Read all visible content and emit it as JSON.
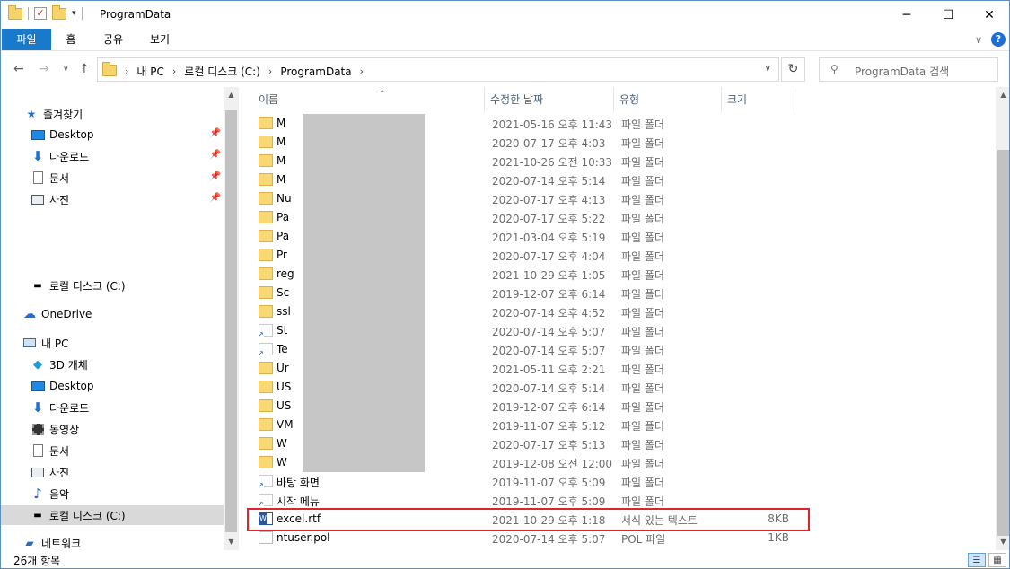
{
  "window": {
    "title": "ProgramData",
    "minimize_glyph": "─",
    "maximize_glyph": "☐",
    "close_glyph": "✕"
  },
  "ribbon": {
    "tabs": [
      "파일",
      "홈",
      "공유",
      "보기"
    ],
    "expand_glyph": "∨",
    "help_glyph": "?"
  },
  "address": {
    "crumbs": [
      "내 PC",
      "로컬 디스크 (C:)",
      "ProgramData"
    ],
    "separator": "›",
    "refresh_glyph": "↻"
  },
  "search": {
    "placeholder": "ProgramData 검색"
  },
  "nav": {
    "quick_access": "즐겨찾기",
    "quick_items": [
      {
        "label": "Desktop",
        "icon": "desktop-icon"
      },
      {
        "label": "다운로드",
        "icon": "download-icon"
      },
      {
        "label": "문서",
        "icon": "document-icon"
      },
      {
        "label": "사진",
        "icon": "picture-icon"
      }
    ],
    "local_disk": "로컬 디스크 (C:)",
    "onedrive": "OneDrive",
    "this_pc": "내 PC",
    "pc_items": [
      {
        "label": "3D 개체",
        "icon": "3d-objects-icon"
      },
      {
        "label": "Desktop",
        "icon": "desktop-icon"
      },
      {
        "label": "다운로드",
        "icon": "download-icon"
      },
      {
        "label": "동영상",
        "icon": "video-icon"
      },
      {
        "label": "문서",
        "icon": "document-icon"
      },
      {
        "label": "사진",
        "icon": "picture-icon"
      },
      {
        "label": "음악",
        "icon": "music-icon"
      },
      {
        "label": "로컬 디스크 (C:)",
        "icon": "drive-icon"
      }
    ],
    "network": "네트워크"
  },
  "columns": {
    "name": "이름",
    "modified": "수정한 날짜",
    "type": "유형",
    "size": "크기"
  },
  "files": [
    {
      "name": "M",
      "date": "2021-05-16 오후 11:43",
      "type": "파일 폴더",
      "size": "",
      "kind": "folder"
    },
    {
      "name": "M",
      "date": "2020-07-17 오후 4:03",
      "type": "파일 폴더",
      "size": "",
      "kind": "folder"
    },
    {
      "name": "M",
      "date": "2021-10-26 오전 10:33",
      "type": "파일 폴더",
      "size": "",
      "kind": "folder"
    },
    {
      "name": "M",
      "date": "2020-07-14 오후 5:14",
      "type": "파일 폴더",
      "size": "",
      "kind": "folder"
    },
    {
      "name": "Nu",
      "date": "2020-07-17 오후 4:13",
      "type": "파일 폴더",
      "size": "",
      "kind": "folder"
    },
    {
      "name": "Pa",
      "date": "2020-07-17 오후 5:22",
      "type": "파일 폴더",
      "size": "",
      "kind": "folder"
    },
    {
      "name": "Pa",
      "date": "2021-03-04 오후 5:19",
      "type": "파일 폴더",
      "size": "",
      "kind": "folder"
    },
    {
      "name": "Pr",
      "date": "2020-07-17 오후 4:04",
      "type": "파일 폴더",
      "size": "",
      "kind": "folder"
    },
    {
      "name": "reg",
      "date": "2021-10-29 오후 1:05",
      "type": "파일 폴더",
      "size": "",
      "kind": "folder"
    },
    {
      "name": "Sc",
      "date": "2019-12-07 오후 6:14",
      "type": "파일 폴더",
      "size": "",
      "kind": "folder"
    },
    {
      "name": "ssl",
      "date": "2020-07-14 오후 4:52",
      "type": "파일 폴더",
      "size": "",
      "kind": "folder"
    },
    {
      "name": "St",
      "date": "2020-07-14 오후 5:07",
      "type": "파일 폴더",
      "size": "",
      "kind": "shortcut"
    },
    {
      "name": "Te",
      "date": "2020-07-14 오후 5:07",
      "type": "파일 폴더",
      "size": "",
      "kind": "shortcut"
    },
    {
      "name": "Ur",
      "date": "2021-05-11 오후 2:21",
      "type": "파일 폴더",
      "size": "",
      "kind": "folder"
    },
    {
      "name": "US",
      "date": "2020-07-14 오후 5:14",
      "type": "파일 폴더",
      "size": "",
      "kind": "folder"
    },
    {
      "name": "US",
      "date": "2019-12-07 오후 6:14",
      "type": "파일 폴더",
      "size": "",
      "kind": "folder"
    },
    {
      "name": "VM",
      "date": "2019-11-07 오후 5:12",
      "type": "파일 폴더",
      "size": "",
      "kind": "folder"
    },
    {
      "name": "W",
      "date": "2020-07-17 오후 5:13",
      "type": "파일 폴더",
      "size": "",
      "kind": "folder"
    },
    {
      "name": "W",
      "date": "2019-12-08 오전 12:00",
      "type": "파일 폴더",
      "size": "",
      "kind": "folder"
    },
    {
      "name": "바탕 화면",
      "date": "2019-11-07 오후 5:09",
      "type": "파일 폴더",
      "size": "",
      "kind": "shortcut"
    },
    {
      "name": "시작 메뉴",
      "date": "2019-11-07 오후 5:09",
      "type": "파일 폴더",
      "size": "",
      "kind": "shortcut"
    },
    {
      "name": "excel.rtf",
      "date": "2021-10-29 오후 1:18",
      "type": "서식 있는 텍스트",
      "size": "8KB",
      "kind": "rtf"
    },
    {
      "name": "ntuser.pol",
      "date": "2020-07-14 오후 5:07",
      "type": "POL 파일",
      "size": "1KB",
      "kind": "pol"
    }
  ],
  "status": {
    "count": "26개 항목"
  },
  "colors": {
    "accent": "#1979ca",
    "highlight_border": "#e0242c",
    "redaction": "#c6c6c6"
  }
}
